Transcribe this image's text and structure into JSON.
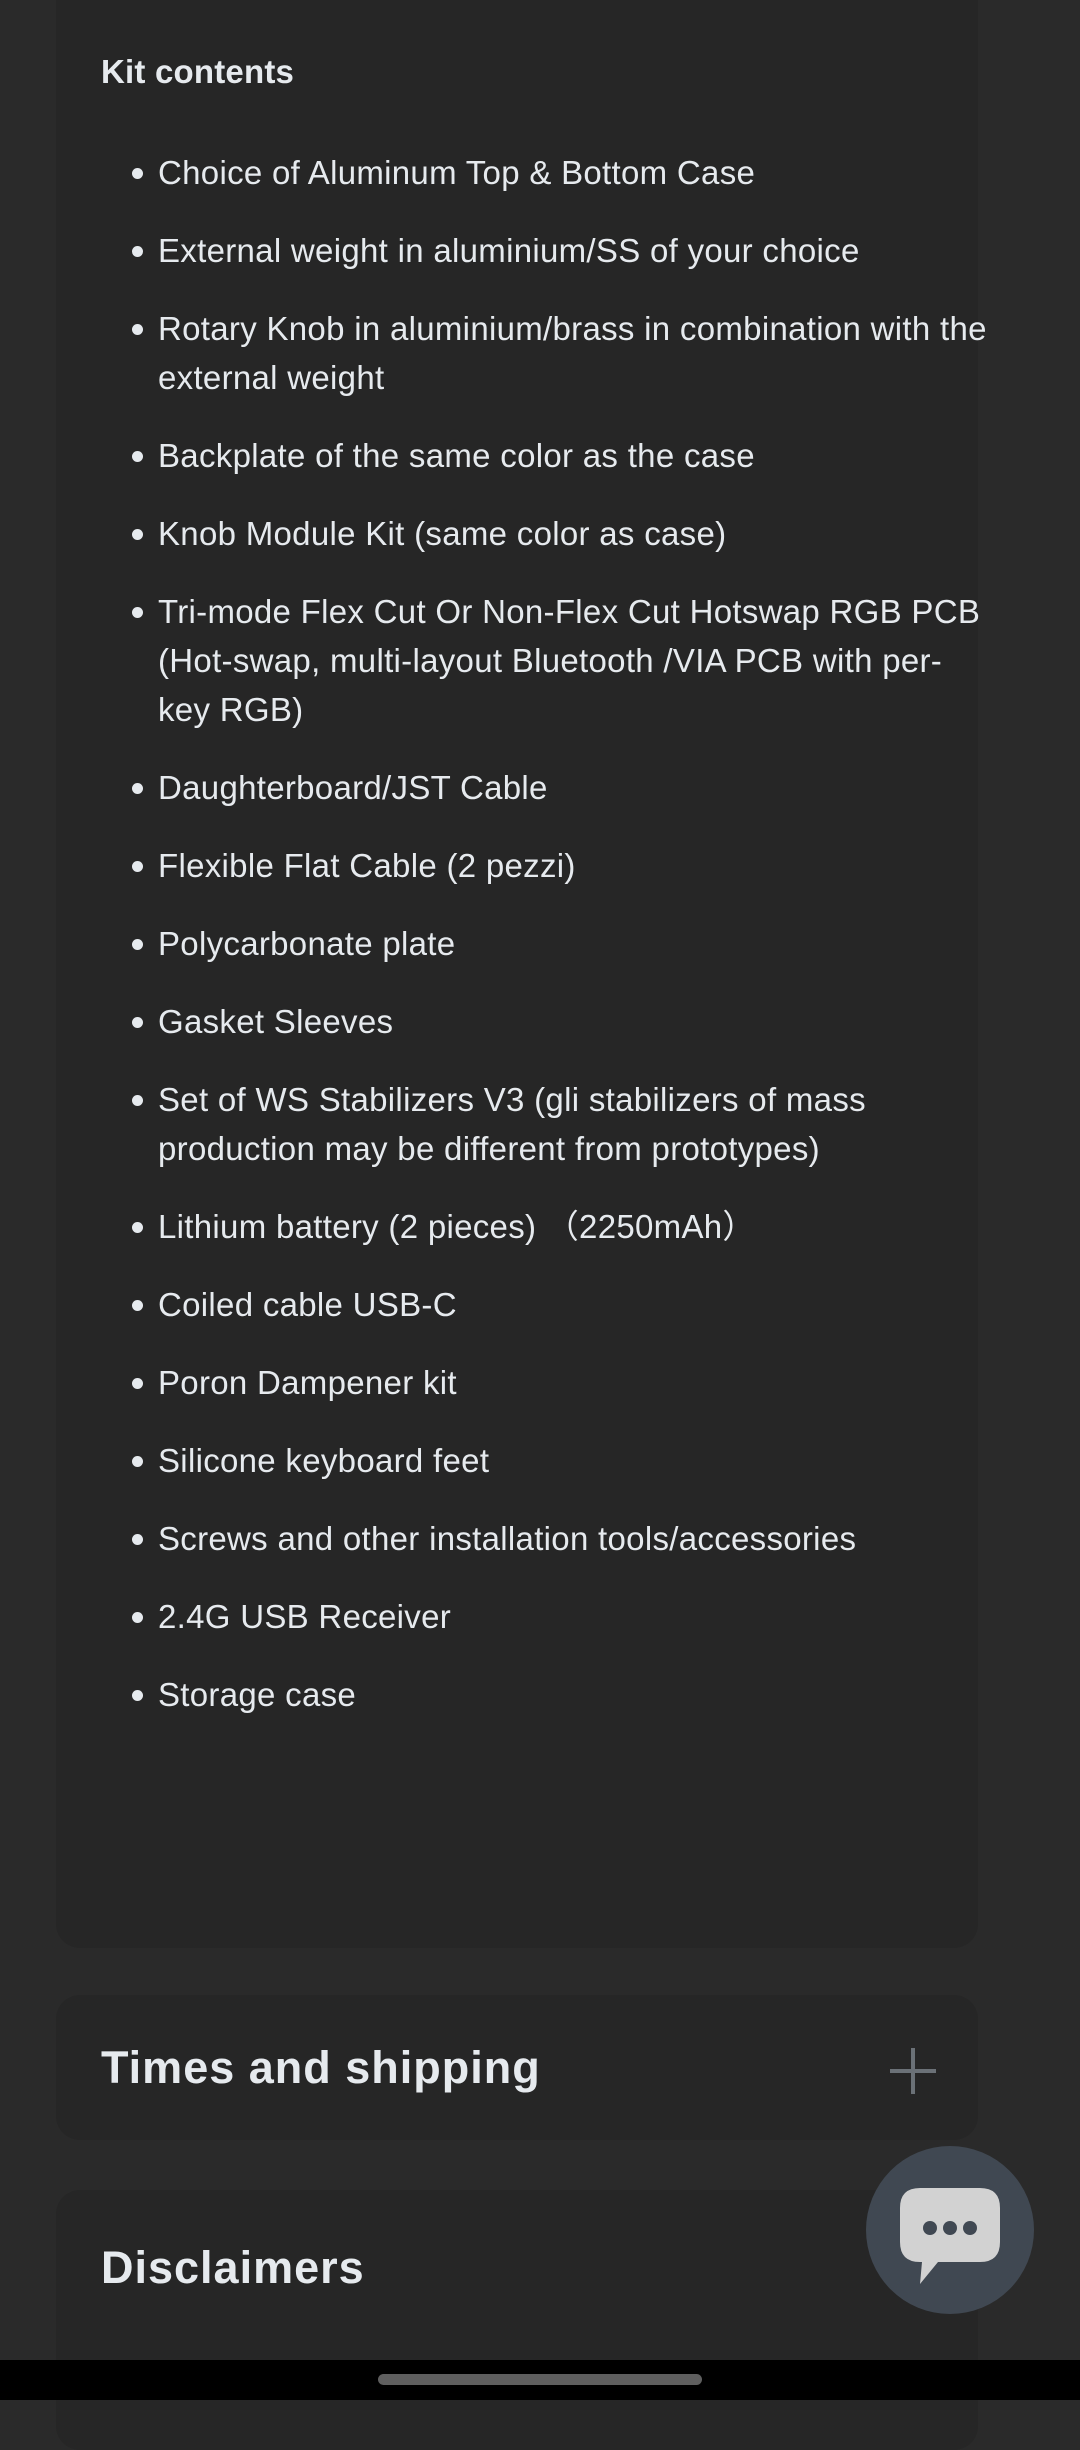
{
  "kit_contents": {
    "heading": "Kit contents",
    "items": [
      "Choice of Aluminum Top & Bottom Case",
      "External weight in aluminium/SS of your choice",
      "Rotary Knob in aluminium/brass in combination with the external weight",
      "Backplate of the same color as the case",
      "Knob Module Kit (same color as case)",
      "Tri-mode Flex Cut Or Non-Flex Cut Hotswap RGB PCB (Hot-swap, multi-layout Bluetooth /VIA PCB with per-key RGB)",
      "Daughterboard/JST Cable",
      "Flexible Flat Cable (2 pezzi)",
      "Polycarbonate plate",
      "Gasket Sleeves",
      "Set of WS Stabilizers V3 (gli stabilizers of mass production may be different from prototypes)",
      "Lithium battery (2 pieces) （2250mAh）",
      "Coiled cable USB-C",
      "Poron Dampener kit",
      "Silicone keyboard feet",
      "Screws and other installation tools/accessories",
      "2.4G USB Receiver",
      "Storage case"
    ]
  },
  "accordions": [
    {
      "title": "Times and shipping",
      "icon": "plus-icon",
      "expanded": false
    },
    {
      "title": "Disclaimers"
    }
  ],
  "chat_button": {
    "icon": "chat-bubble-icon"
  },
  "colors": {
    "page_bg": "#2a2a2a",
    "card_bg": "#262626",
    "text": "#e6eaee",
    "icon_muted": "#6b7177",
    "chat_fab": "#404852"
  }
}
